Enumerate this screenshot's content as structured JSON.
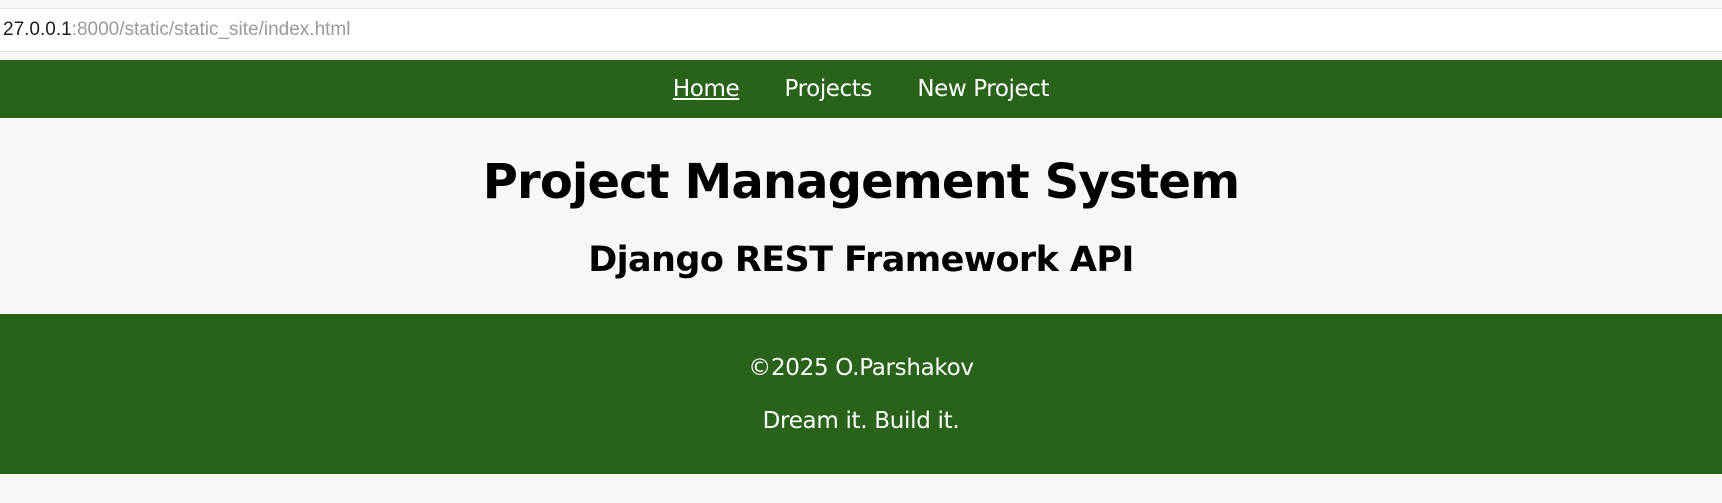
{
  "browser": {
    "url_host": "27.0.0.1",
    "url_path": ":8000/static/static_site/index.html"
  },
  "nav": {
    "items": [
      {
        "label": "Home",
        "active": true
      },
      {
        "label": "Projects",
        "active": false
      },
      {
        "label": "New Project",
        "active": false
      }
    ]
  },
  "header": {
    "title": "Project Management System",
    "subtitle": "Django REST Framework API"
  },
  "footer": {
    "copyright": "©2025 O.Parshakov",
    "tagline": "Dream it. Build it."
  },
  "colors": {
    "primary_green": "#286319",
    "page_background": "#f7f7f7",
    "text_dark": "#000000",
    "text_light": "#ffffff"
  }
}
